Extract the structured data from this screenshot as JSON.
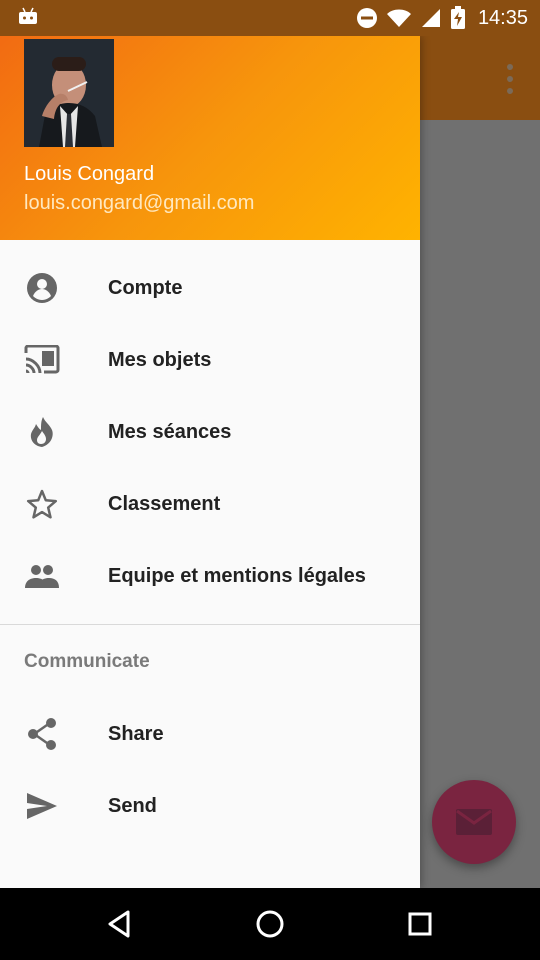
{
  "status_bar": {
    "time": "14:35",
    "icons": [
      "android-icon",
      "do-not-disturb-icon",
      "wifi-icon",
      "cellular-signal-icon",
      "battery-charging-icon"
    ]
  },
  "app": {
    "toolbar_color": "#8a4e11",
    "overflow_icon": "more-vert-icon",
    "fab_icon": "mail-icon",
    "fab_color": "#7a2440"
  },
  "drawer": {
    "header": {
      "name": "Louis Congard",
      "email": "louis.congard@gmail.com",
      "gradient": [
        "#f26b12",
        "#ffb300"
      ]
    },
    "primary_items": [
      {
        "label": "Compte",
        "icon": "account-circle-icon"
      },
      {
        "label": "Mes objets",
        "icon": "cast-icon"
      },
      {
        "label": "Mes séances",
        "icon": "flame-icon"
      },
      {
        "label": "Classement",
        "icon": "star-outline-icon"
      },
      {
        "label": "Equipe et mentions légales",
        "icon": "people-icon"
      }
    ],
    "secondary_section": {
      "title": "Communicate",
      "items": [
        {
          "label": "Share",
          "icon": "share-icon"
        },
        {
          "label": "Send",
          "icon": "send-icon"
        }
      ]
    }
  },
  "navigation_bar": {
    "buttons": [
      "back-icon",
      "home-icon",
      "recents-icon"
    ]
  }
}
